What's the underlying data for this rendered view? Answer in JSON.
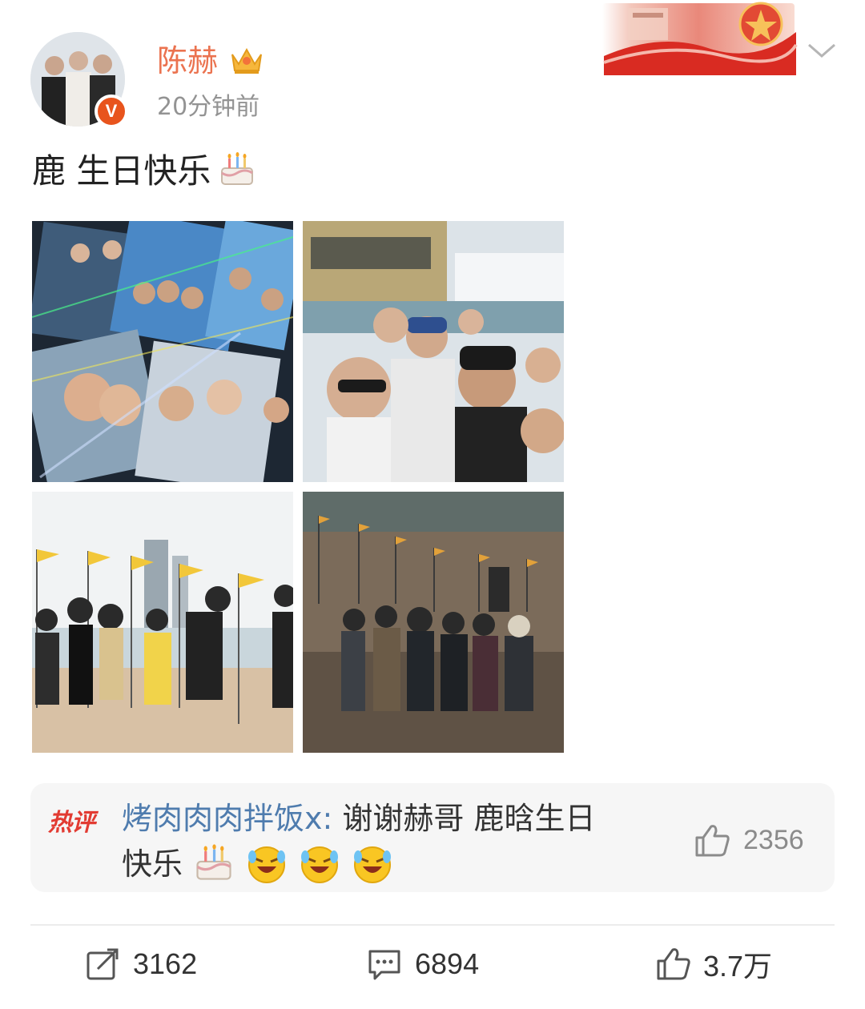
{
  "post": {
    "author": "陈赫",
    "time": "20分钟前",
    "text": "鹿 生日快乐",
    "text_emoji": "cake-emoji",
    "verified_badge": "V",
    "member_icon": "crown-icon"
  },
  "images": [
    {
      "name": "photo-cards-collage"
    },
    {
      "name": "photo-yacht-selfie"
    },
    {
      "name": "photo-beach-flags"
    },
    {
      "name": "photo-beach-walk"
    }
  ],
  "hot_comment": {
    "label": "热评",
    "commenter": "烤肉肉肉拌饭x",
    "separator": ":",
    "text_line1": " 谢谢赫哥 鹿晗生日",
    "text_line2": "快乐",
    "emojis": [
      "cake-emoji",
      "laugh-cry-emoji",
      "laugh-cry-emoji",
      "laugh-cry-emoji"
    ],
    "likes": "2356"
  },
  "actions": {
    "repost_count": "3162",
    "comment_count": "6894",
    "like_count": "3.7万"
  },
  "colors": {
    "username": "#eb7350",
    "commenter": "#4f7cae",
    "hot_label": "#e23b32",
    "meta_gray": "#939393"
  }
}
